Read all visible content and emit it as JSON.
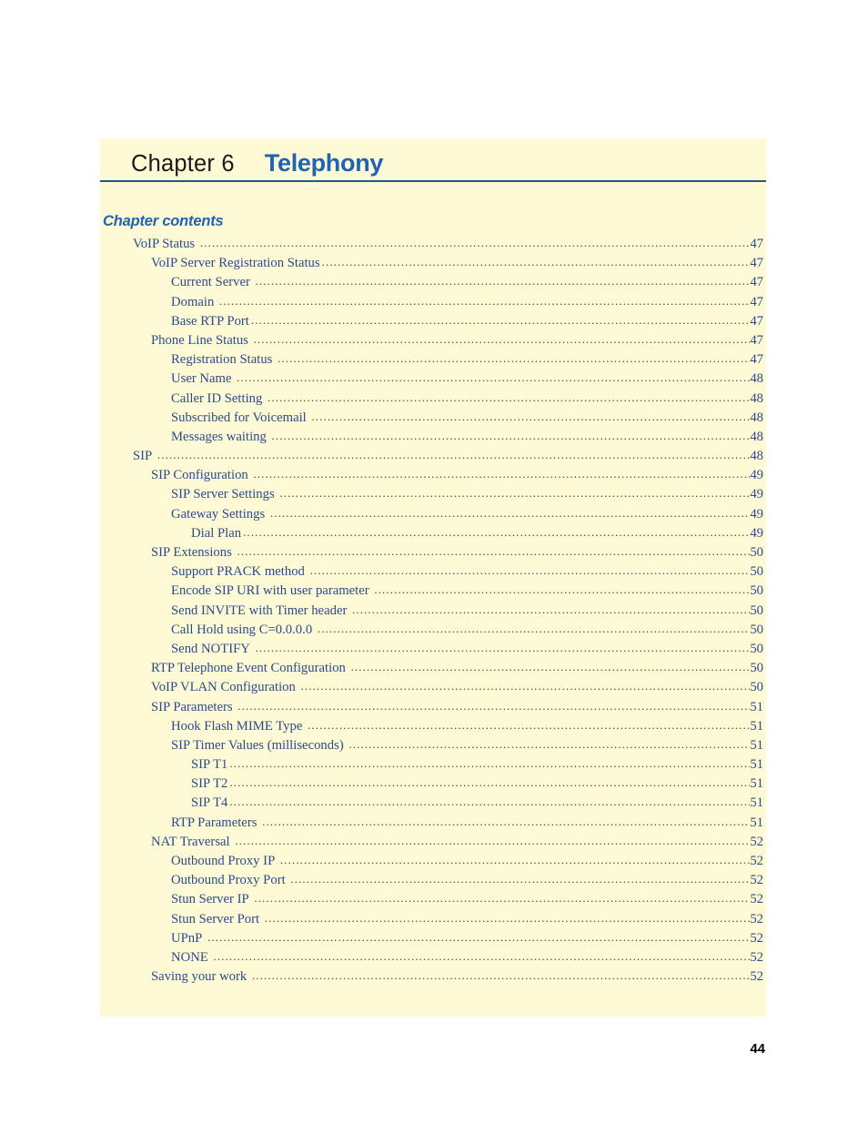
{
  "page": {
    "page_number": "44",
    "background_color": "#ffffff",
    "panel_color": "#fdfad5",
    "rule_color": "#1b5c80",
    "heading_accent_color": "#1f63b5",
    "toc_text_color": "#2c4b8d"
  },
  "chapter": {
    "number_label": "Chapter 6",
    "name": "Telephony",
    "contents_heading": "Chapter contents"
  },
  "toc": {
    "entries": [
      {
        "label": "VoIP Status",
        "page": "47",
        "level": 1,
        "gap": true
      },
      {
        "label": "VoIP Server Registration Status",
        "page": "47",
        "level": 2,
        "gap": false
      },
      {
        "label": "Current Server",
        "page": "47",
        "level": 3,
        "gap": true
      },
      {
        "label": "Domain",
        "page": "47",
        "level": 3,
        "gap": true
      },
      {
        "label": "Base RTP Port",
        "page": "47",
        "level": 3,
        "gap": false
      },
      {
        "label": "Phone Line Status",
        "page": "47",
        "level": 2,
        "gap": true
      },
      {
        "label": "Registration Status",
        "page": "47",
        "level": 3,
        "gap": true
      },
      {
        "label": "User Name",
        "page": "48",
        "level": 3,
        "gap": true
      },
      {
        "label": "Caller ID Setting",
        "page": "48",
        "level": 3,
        "gap": true
      },
      {
        "label": "Subscribed for Voicemail",
        "page": "48",
        "level": 3,
        "gap": true
      },
      {
        "label": "Messages waiting",
        "page": "48",
        "level": 3,
        "gap": true
      },
      {
        "label": "SIP",
        "page": "48",
        "level": 1,
        "gap": true
      },
      {
        "label": "SIP Configuration",
        "page": "49",
        "level": 2,
        "gap": true
      },
      {
        "label": "SIP Server Settings",
        "page": "49",
        "level": 3,
        "gap": true
      },
      {
        "label": "Gateway Settings",
        "page": "49",
        "level": 3,
        "gap": true
      },
      {
        "label": "Dial Plan",
        "page": "49",
        "level": 4,
        "gap": false
      },
      {
        "label": "SIP Extensions",
        "page": "50",
        "level": 2,
        "gap": true
      },
      {
        "label": "Support PRACK method",
        "page": "50",
        "level": 3,
        "gap": true
      },
      {
        "label": "Encode SIP URI with user parameter",
        "page": "50",
        "level": 3,
        "gap": true
      },
      {
        "label": "Send INVITE with Timer header",
        "page": "50",
        "level": 3,
        "gap": true
      },
      {
        "label": "Call Hold using C=0.0.0.0",
        "page": "50",
        "level": 3,
        "gap": true
      },
      {
        "label": "Send NOTIFY",
        "page": "50",
        "level": 3,
        "gap": true
      },
      {
        "label": "RTP Telephone Event Configuration",
        "page": "50",
        "level": 2,
        "gap": true
      },
      {
        "label": "VoIP VLAN Configuration",
        "page": "50",
        "level": 2,
        "gap": true
      },
      {
        "label": "SIP Parameters",
        "page": "51",
        "level": 2,
        "gap": true
      },
      {
        "label": "Hook Flash MIME Type",
        "page": "51",
        "level": 3,
        "gap": true
      },
      {
        "label": "SIP Timer Values (milliseconds)",
        "page": "51",
        "level": 3,
        "gap": true
      },
      {
        "label": "SIP T1",
        "page": "51",
        "level": 4,
        "gap": false
      },
      {
        "label": "SIP T2",
        "page": "51",
        "level": 4,
        "gap": false
      },
      {
        "label": "SIP T4",
        "page": "51",
        "level": 4,
        "gap": false
      },
      {
        "label": "RTP Parameters",
        "page": "51",
        "level": 3,
        "gap": true
      },
      {
        "label": "NAT Traversal",
        "page": "52",
        "level": 2,
        "gap": true
      },
      {
        "label": "Outbound Proxy IP",
        "page": "52",
        "level": 3,
        "gap": true
      },
      {
        "label": "Outbound Proxy Port",
        "page": "52",
        "level": 3,
        "gap": true
      },
      {
        "label": "Stun Server IP",
        "page": "52",
        "level": 3,
        "gap": true
      },
      {
        "label": "Stun Server Port",
        "page": "52",
        "level": 3,
        "gap": true
      },
      {
        "label": "UPnP",
        "page": "52",
        "level": 3,
        "gap": true
      },
      {
        "label": "NONE",
        "page": "52",
        "level": 3,
        "gap": true
      },
      {
        "label": "Saving your work",
        "page": "52",
        "level": 2,
        "gap": true
      }
    ]
  }
}
